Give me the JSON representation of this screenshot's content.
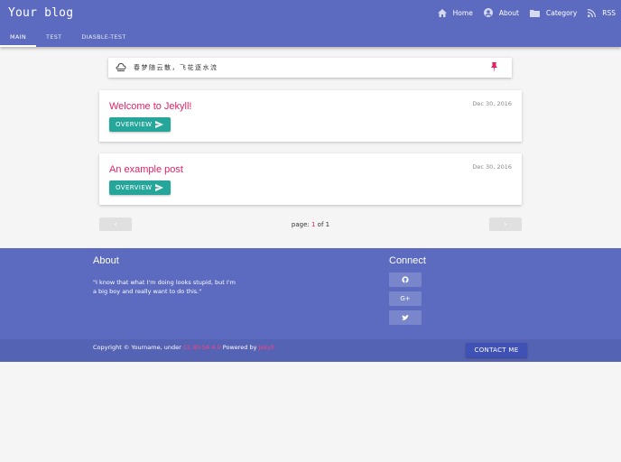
{
  "header": {
    "brand": "Your blog",
    "nav": [
      {
        "label": "Home",
        "icon": "home-icon"
      },
      {
        "label": "About",
        "icon": "account-icon"
      },
      {
        "label": "Category",
        "icon": "folder-icon"
      },
      {
        "label": "RSS",
        "icon": "rss-icon"
      }
    ],
    "tabs": [
      "MAIN",
      "TEST",
      "DIASBLE-TEST"
    ],
    "active_tab": "MAIN"
  },
  "quote": {
    "text": "春梦随云散，飞花逐水流",
    "left_icon": "cloud-icon",
    "right_icon": "pin-icon"
  },
  "posts": [
    {
      "title": "Welcome to Jekyll!",
      "date": "Dec 30, 2016",
      "button": "OVERVIEW"
    },
    {
      "title": "An example post",
      "date": "Dec 30, 2016",
      "button": "OVERVIEW"
    }
  ],
  "pagination": {
    "prev": "‹",
    "next": "›",
    "prefix": "page: ",
    "current": "1",
    "suffix": " of 1"
  },
  "footer": {
    "about_title": "About",
    "about_text": "\"I know that what I'm doing looks stupid, but I'm a big boy and really want to do this.\"",
    "connect_title": "Connect",
    "social": [
      {
        "icon": "github-icon",
        "glyph": "◉"
      },
      {
        "icon": "google-plus-icon",
        "glyph": "G+"
      },
      {
        "icon": "twitter-icon",
        "glyph": "🐦"
      }
    ],
    "copyright_prefix": "Copyright © Yourname, under ",
    "license": "CC BY-SA 4.0",
    "powered": " Powered by ",
    "engine": "Jekyll.",
    "contact_button": "CONTACT ME"
  },
  "colors": {
    "primary": "#5c6bc0",
    "accent": "#e91e63",
    "teal": "#26a69a",
    "contact": "#3f51b5"
  }
}
